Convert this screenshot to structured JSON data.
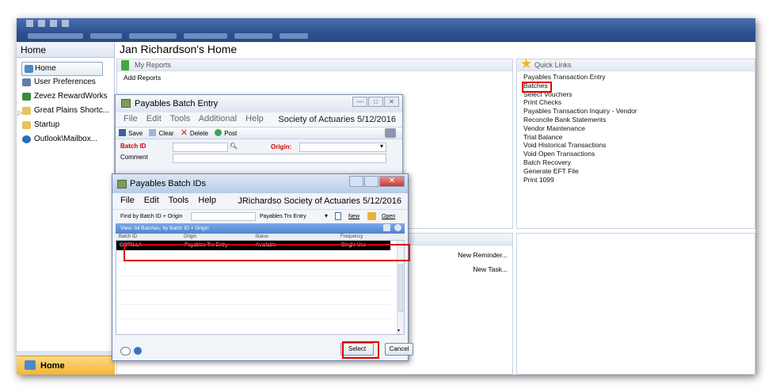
{
  "app": {
    "nav_header": "Home",
    "page_title": "Jan Richardson's Home",
    "nav_items": [
      {
        "label": "Home",
        "icon": "home-icon"
      },
      {
        "label": "User Preferences",
        "icon": "user-preferences-icon"
      },
      {
        "label": "Zevez RewardWorks",
        "icon": "rewardworks-icon"
      },
      {
        "label": "Great Plains Shortc...",
        "icon": "folder-icon"
      },
      {
        "label": "Startup",
        "icon": "folder-icon"
      },
      {
        "label": "Outlook\\Mailbox...",
        "icon": "outlook-icon"
      }
    ],
    "nav_bottom": "Home"
  },
  "my_reports": {
    "title": "My Reports",
    "add_reports": "Add Reports"
  },
  "quick_links": {
    "title": "Quick Links",
    "items": [
      "Payables Transaction Entry",
      "Batches",
      "Select Vouchers",
      "Print Checks",
      "Payables Transaction Inquiry - Vendor",
      "Reconcile Bank Statements",
      "Vendor Maintenance",
      "Trial Balance",
      "Void Historical Transactions",
      "Void Open Transactions",
      "Batch Recovery",
      "Generate EFT File",
      "Print 1099"
    ]
  },
  "reminders": {
    "new_reminder": "New Reminder...",
    "new_task": "New Task..."
  },
  "batch_entry": {
    "title": "Payables Batch Entry",
    "menu": [
      "File",
      "Edit",
      "Tools",
      "Additional",
      "Help"
    ],
    "company_date": "Society of Actuaries  5/12/2016",
    "toolbar": {
      "save": "Save",
      "clear": "Clear",
      "delete": "Delete",
      "post": "Post"
    },
    "batch_id_label": "Batch ID",
    "origin_label": "Origin:",
    "comment_label": "Comment"
  },
  "batch_ids": {
    "title": "Payables Batch IDs",
    "menu": [
      "File",
      "Edit",
      "Tools",
      "Help"
    ],
    "user_company_date": "JRichardso  Society of Actuaries  5/12/2016",
    "find_label": "Find by Batch ID + Origin",
    "find_value": "",
    "origin_dropdown": "Payables Trx Entry",
    "new_label": "New",
    "open_label": "Open",
    "view_label": "View: All Batches; by Batch ID + Origin",
    "columns": [
      "Batch ID",
      "Origin",
      "Status",
      "Frequency"
    ],
    "rows": [
      {
        "batch_id": "GORILLA",
        "origin": "Payables Trx Entry",
        "status": "Available",
        "frequency": "Single Use"
      }
    ],
    "select_label": "Select",
    "cancel_label": "Cancel"
  },
  "colors": {
    "highlight_red": "#e00000",
    "title_bar": "#2d5191",
    "selected_row": "#000000",
    "nav_active": "#f5b634"
  }
}
